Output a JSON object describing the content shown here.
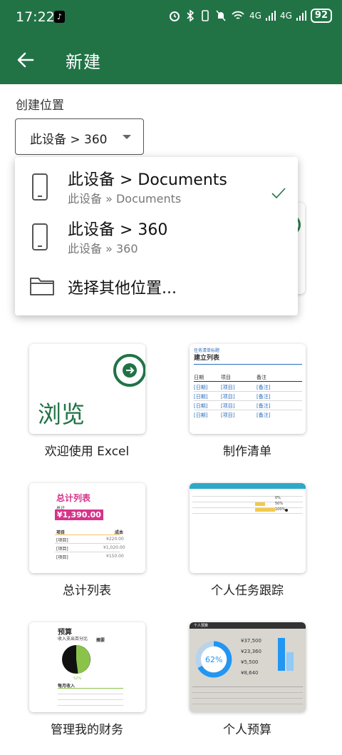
{
  "status": {
    "time": "17:22",
    "battery": "92",
    "signal1": "4G",
    "signal2": "4G"
  },
  "appbar": {
    "title": "新建"
  },
  "location": {
    "label": "创建位置",
    "selected": "此设备 > 360"
  },
  "dropdown": {
    "items": [
      {
        "title": "此设备 > Documents",
        "subtitle": "此设备 » Documents",
        "checked": true,
        "icon": "phone-icon"
      },
      {
        "title": "此设备 > 360",
        "subtitle": "此设备 » 360",
        "checked": false,
        "icon": "phone-icon"
      },
      {
        "title": "选择其他位置...",
        "subtitle": "",
        "checked": false,
        "icon": "folder-icon"
      }
    ]
  },
  "templates": [
    {
      "label": "欢迎使用 Excel",
      "thumb_text": "浏览"
    },
    {
      "label": "制作清单",
      "thumb_title_small": "任务清单标题",
      "thumb_title": "建立列表",
      "cols": [
        "日期",
        "项目",
        "备注"
      ],
      "cell_date": "[日期]",
      "cell_item": "[项目]",
      "cell_note": "[备注]"
    },
    {
      "label": "总计列表",
      "thumb_title": "总计列表",
      "total_label": "总计",
      "total": "¥1,390.00",
      "col1": "项目",
      "col2": "成本",
      "row_item": "[项目]",
      "amounts": [
        "¥220.00",
        "¥1,020.00",
        "¥150.00"
      ]
    },
    {
      "label": "个人任务跟踪",
      "pcts": [
        "0%",
        "50%",
        "100%"
      ]
    },
    {
      "label": "管理我的财务",
      "thumb_title": "预算",
      "thumb_sub": "收入支出百分比",
      "thumb_col": "摘要",
      "pct": "52%",
      "income": "每月收入"
    },
    {
      "label": "个人预算",
      "thumb_title": "个人预算",
      "pct": "62%",
      "amounts": [
        "¥37,500",
        "¥23,360",
        "¥5,500",
        "¥8,640"
      ]
    }
  ],
  "colors": {
    "brand": "#217346",
    "pink": "#d6338a",
    "lime": "#8bc34a",
    "teal": "#2fa8c8",
    "chart_blue": "#2196f3"
  }
}
